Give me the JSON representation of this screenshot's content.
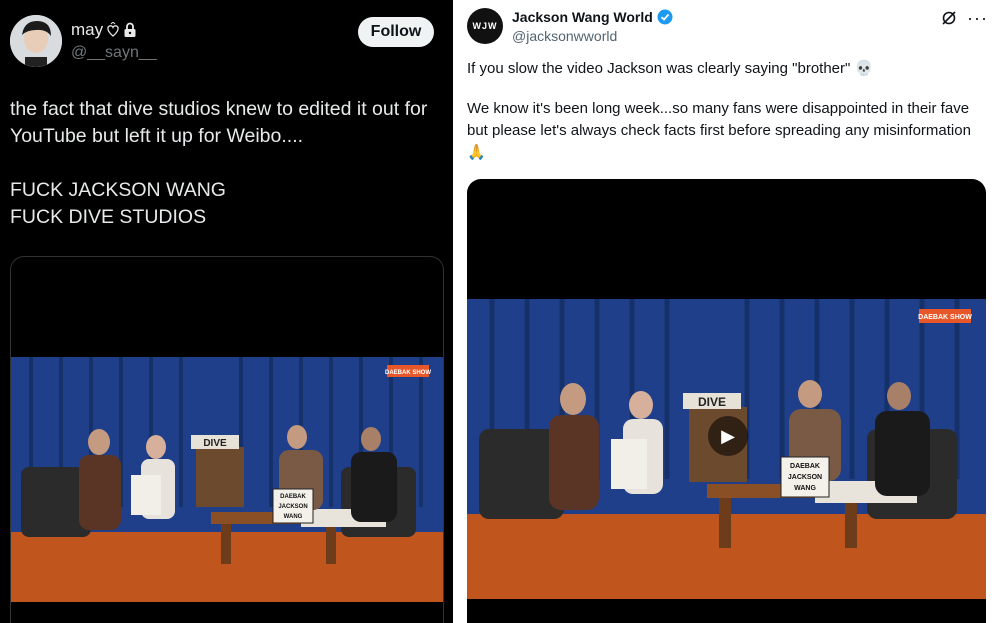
{
  "left_tweet": {
    "display_name": "may",
    "name_suffix_icon": "heart-outline-icon",
    "lock_icon": "lock-icon",
    "handle": "@__sayn__",
    "follow_label": "Follow",
    "paragraphs": [
      "the fact that dive studios knew to edited it out for YouTube but left it up for Weibo....",
      "FUCK JACKSON WANG",
      "FUCK DIVE STUDIOS"
    ],
    "video": {
      "dive_sign": "DIVE",
      "daebak_badge": "DAEBAK SHOW",
      "card_lines": [
        "DAEBAK",
        "JACKSON",
        "WANG"
      ]
    }
  },
  "right_tweet": {
    "avatar_label": "WJW",
    "display_name": "Jackson Wang World",
    "verified_icon": "verified-badge-icon",
    "handle": "@jacksonwworld",
    "grok_icon": "grok-icon",
    "more_icon": "more-options-icon",
    "paragraph1": "If you slow the video Jackson was clearly saying \"brother\" 💀",
    "paragraph2": "We know it's been long week...so many fans were disappointed in their fave but please let's always check facts first before spreading any misinformation 🙏",
    "video": {
      "dive_sign": "DIVE",
      "daebak_badge": "DAEBAK SHOW",
      "card_lines": [
        "DAEBAK",
        "JACKSON",
        "WANG"
      ],
      "play_icon": "play-icon"
    }
  },
  "colors": {
    "left_bg": "#000000",
    "curtain": "#1f3f8a",
    "floor": "#c0561e",
    "verified": "#1d9bf0"
  }
}
